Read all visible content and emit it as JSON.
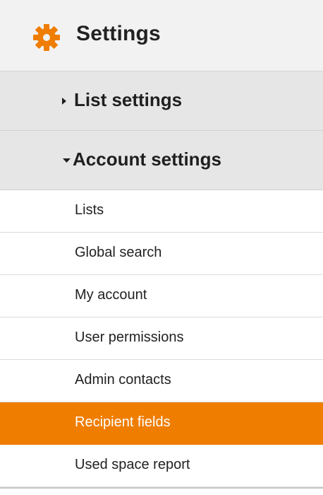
{
  "header": {
    "title": "Settings",
    "icon": "gear-icon",
    "icon_color": "#ef7d00"
  },
  "sections": {
    "list_settings": {
      "label": "List settings",
      "state": "collapsed",
      "icon": "caret-right-icon"
    },
    "account_settings": {
      "label": "Account settings",
      "state": "expanded",
      "icon": "caret-down-icon"
    }
  },
  "account_items": [
    {
      "label": "Lists"
    },
    {
      "label": "Global search"
    },
    {
      "label": "My account"
    },
    {
      "label": "User permissions"
    },
    {
      "label": "Admin contacts"
    },
    {
      "label": "Recipient fields",
      "active": true
    },
    {
      "label": "Used space report"
    }
  ],
  "colors": {
    "accent": "#ef7d00",
    "header_bg": "#f2f2f2",
    "section_bg": "#e6e6e6"
  }
}
